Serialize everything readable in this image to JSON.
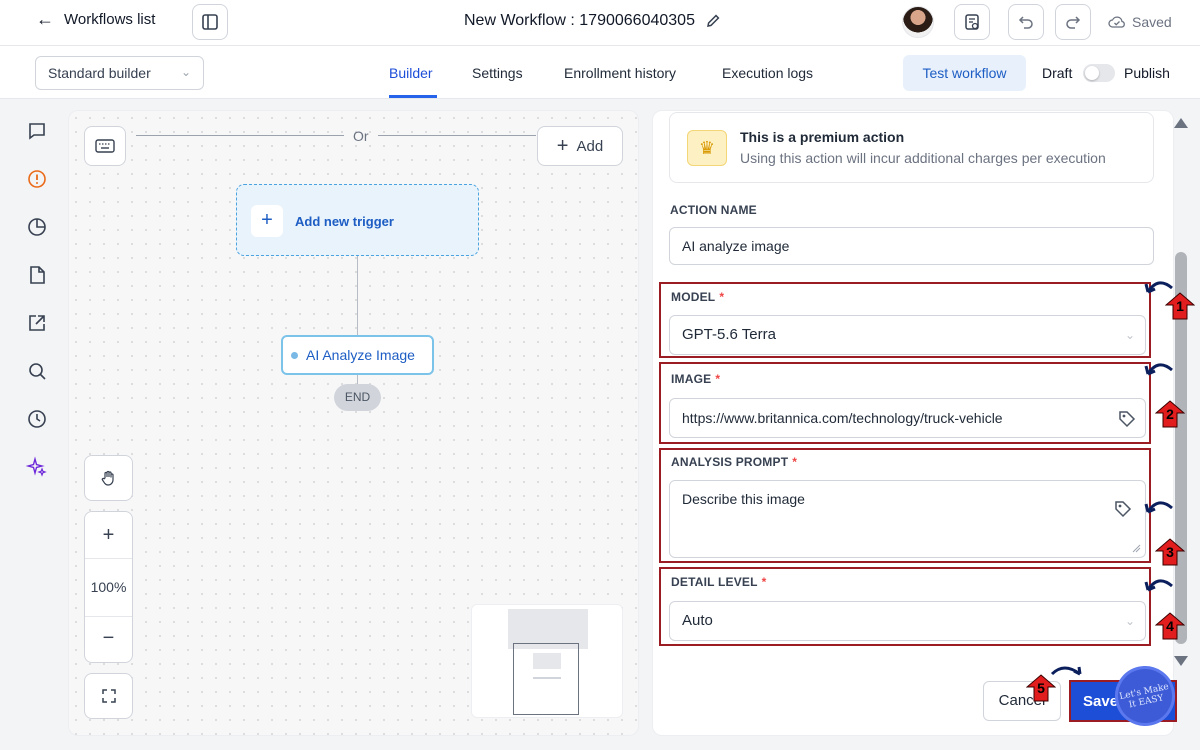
{
  "header": {
    "back_label": "Workflows list",
    "title": "New Workflow : 1790066040305",
    "saved_label": "Saved"
  },
  "subnav": {
    "builder_select": "Standard builder",
    "tabs": [
      {
        "label": "Builder",
        "active": true
      },
      {
        "label": "Settings",
        "active": false
      },
      {
        "label": "Enrollment history",
        "active": false
      },
      {
        "label": "Execution logs",
        "active": false
      }
    ],
    "test_button": "Test workflow",
    "draft_label": "Draft",
    "publish_label": "Publish"
  },
  "sidebar": {
    "icons": [
      "chat-icon",
      "alert-icon",
      "chart-icon",
      "document-icon",
      "external-link-icon",
      "search-icon",
      "history-icon",
      "sparkle-icon"
    ]
  },
  "canvas": {
    "or_label": "Or",
    "add_label": "Add",
    "trigger_label": "Add new trigger",
    "node_label": "AI Analyze Image",
    "end_label": "END",
    "zoom": "100%"
  },
  "panel": {
    "premium_title": "This is a premium action",
    "premium_sub": "Using this action will incur additional charges per execution",
    "action_name_label": "ACTION NAME",
    "action_name_value": "AI analyze image",
    "model_label": "MODEL",
    "model_value": "GPT-5.6 Terra",
    "image_label": "IMAGE",
    "image_value": "https://www.britannica.com/technology/truck-vehicle",
    "prompt_label": "ANALYSIS PROMPT",
    "prompt_value": "Describe this image",
    "detail_label": "DETAIL LEVEL",
    "detail_value": "Auto",
    "required_mark": "*",
    "cancel_label": "Cancel",
    "save_label": "Save"
  },
  "annotations": {
    "markers": [
      "1",
      "2",
      "3",
      "4",
      "5"
    ],
    "badge_text": "Let's Make It EASY",
    "box_color": "#9b1c22",
    "arrow_color": "#e11d1d"
  },
  "colors": {
    "accent": "#2563eb",
    "node_border": "#7cc3ea",
    "premium_bg": "#fdf0c2"
  }
}
